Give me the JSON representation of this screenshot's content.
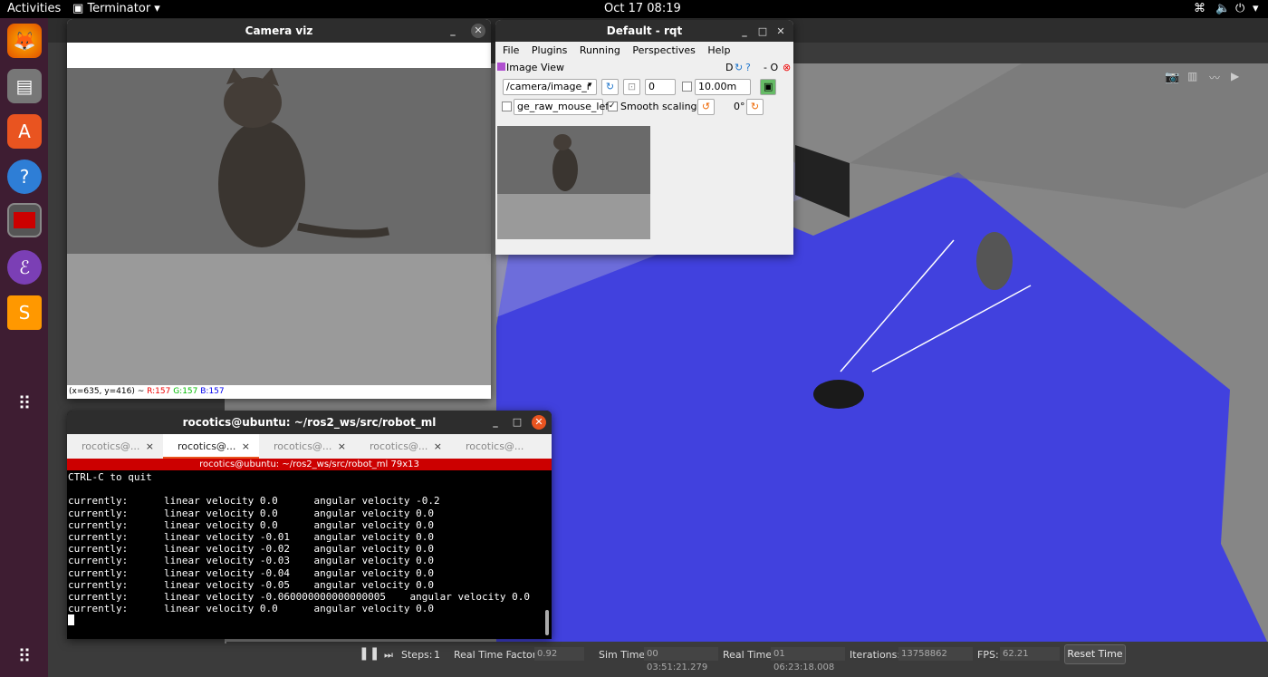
{
  "topbar": {
    "activities": "Activities",
    "app": "Terminator",
    "datetime": "Oct 17  08:19"
  },
  "dock": {
    "items": [
      "firefox-icon",
      "files-icon",
      "software-icon",
      "help-icon",
      "terminator-icon",
      "emacs-icon",
      "sublime-icon",
      "apps-grid-icon"
    ]
  },
  "camera_viz": {
    "title": "Camera viz",
    "status_coords": "(x=635, y=416) ~",
    "r": "R:157",
    "g": "G:157",
    "b": "B:157"
  },
  "rqt": {
    "title": "Default - rqt",
    "menu": [
      "File",
      "Plugins",
      "Running",
      "Perspectives",
      "Help"
    ],
    "plugin_title": "Image View",
    "plugin_flags": "D",
    "plugin_close": "- O",
    "topic": "/camera/image_r",
    "spin_value": "0",
    "max_range": "10.00m",
    "mouse_topic": "ge_raw_mouse_left",
    "smooth_label": "Smooth scaling",
    "rotation": "0°"
  },
  "terminal": {
    "title": "rocotics@ubuntu: ~/ros2_ws/src/robot_ml",
    "tabs": [
      "rocotics@...",
      "rocotics@...",
      "rocotics@...",
      "rocotics@...",
      "rocotics@..."
    ],
    "active_tab": 1,
    "pane_title": "rocotics@ubuntu: ~/ros2_ws/src/robot_ml 79x13",
    "lines": [
      "CTRL-C to quit",
      "",
      "currently:      linear velocity 0.0      angular velocity -0.2",
      "currently:      linear velocity 0.0      angular velocity 0.0",
      "currently:      linear velocity 0.0      angular velocity 0.0",
      "currently:      linear velocity -0.01    angular velocity 0.0",
      "currently:      linear velocity -0.02    angular velocity 0.0",
      "currently:      linear velocity -0.03    angular velocity 0.0",
      "currently:      linear velocity -0.04    angular velocity 0.0",
      "currently:      linear velocity -0.05    angular velocity 0.0",
      "currently:      linear velocity -0.060000000000000005    angular velocity 0.0",
      "currently:      linear velocity 0.0      angular velocity 0.0"
    ]
  },
  "gazebo_bar": {
    "steps_label": "Steps:",
    "steps_value": "1",
    "rtf_label": "Real Time Factor:",
    "rtf_value": "0.92",
    "sim_label": "Sim Time:",
    "sim_value": "00 03:51:21.279",
    "real_label": "Real Time:",
    "real_value": "01 06:23:18.008",
    "iter_label": "Iterations:",
    "iter_value": "13758862",
    "fps_label": "FPS:",
    "fps_value": "62.21",
    "reset_label": "Reset Time"
  },
  "colors": {
    "laser": "#3a3ae8",
    "dock": "#3e1d32",
    "term_red": "#cc0000"
  }
}
